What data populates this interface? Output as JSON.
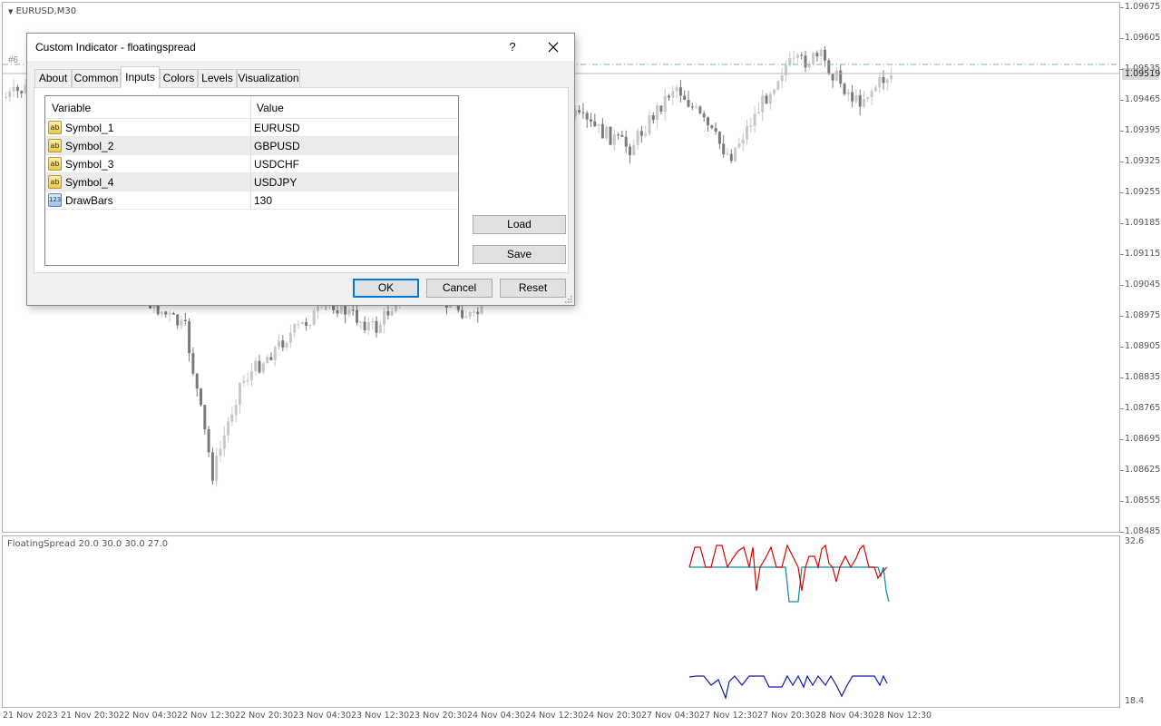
{
  "chart": {
    "symbol_title": "EURUSD,M30",
    "order_tag": "#6",
    "indicator_title": "FloatingSpread 20.0 30.0 30.0 27.0",
    "current_price": "1.09519",
    "price_labels": [
      "1.09675",
      "1.09605",
      "1.09535",
      "1.09465",
      "1.09395",
      "1.09325",
      "1.09255",
      "1.09185",
      "1.09115",
      "1.09045",
      "1.08975",
      "1.08905",
      "1.08835",
      "1.08765",
      "1.08695",
      "1.08625",
      "1.08555",
      "1.08485"
    ],
    "sub_labels": [
      "32.6",
      "18.4"
    ],
    "time_labels": [
      "21 Nov 2023",
      "21 Nov 20:30",
      "22 Nov 04:30",
      "22 Nov 12:30",
      "22 Nov 20:30",
      "23 Nov 04:30",
      "23 Nov 12:30",
      "23 Nov 20:30",
      "24 Nov 04:30",
      "24 Nov 12:30",
      "24 Nov 20:30",
      "27 Nov 04:30",
      "27 Nov 12:30",
      "27 Nov 20:30",
      "28 Nov 04:30",
      "28 Nov 12:30"
    ],
    "colors": {
      "bull": "#c8c8c8",
      "bear": "#7a7a7a",
      "red_line": "#e00000",
      "teal_line": "#0e8a9a",
      "blue_line": "#1018b0",
      "bid_line": "#6cc06c"
    }
  },
  "dialog": {
    "title": "Custom Indicator - floatingspread",
    "help": "?",
    "tabs": [
      "About",
      "Common",
      "Inputs",
      "Colors",
      "Levels",
      "Visualization"
    ],
    "active_tab": "Inputs",
    "grid": {
      "headers": {
        "variable": "Variable",
        "value": "Value"
      },
      "rows": [
        {
          "icon": "ab",
          "variable": "Symbol_1",
          "value": "EURUSD"
        },
        {
          "icon": "ab",
          "variable": "Symbol_2",
          "value": "GBPUSD"
        },
        {
          "icon": "ab",
          "variable": "Symbol_3",
          "value": "USDCHF"
        },
        {
          "icon": "ab",
          "variable": "Symbol_4",
          "value": "USDJPY"
        },
        {
          "icon": "123",
          "variable": "DrawBars",
          "value": "130"
        }
      ]
    },
    "load_label": "Load",
    "save_label": "Save",
    "ok_label": "OK",
    "cancel_label": "Cancel",
    "reset_label": "Reset"
  }
}
